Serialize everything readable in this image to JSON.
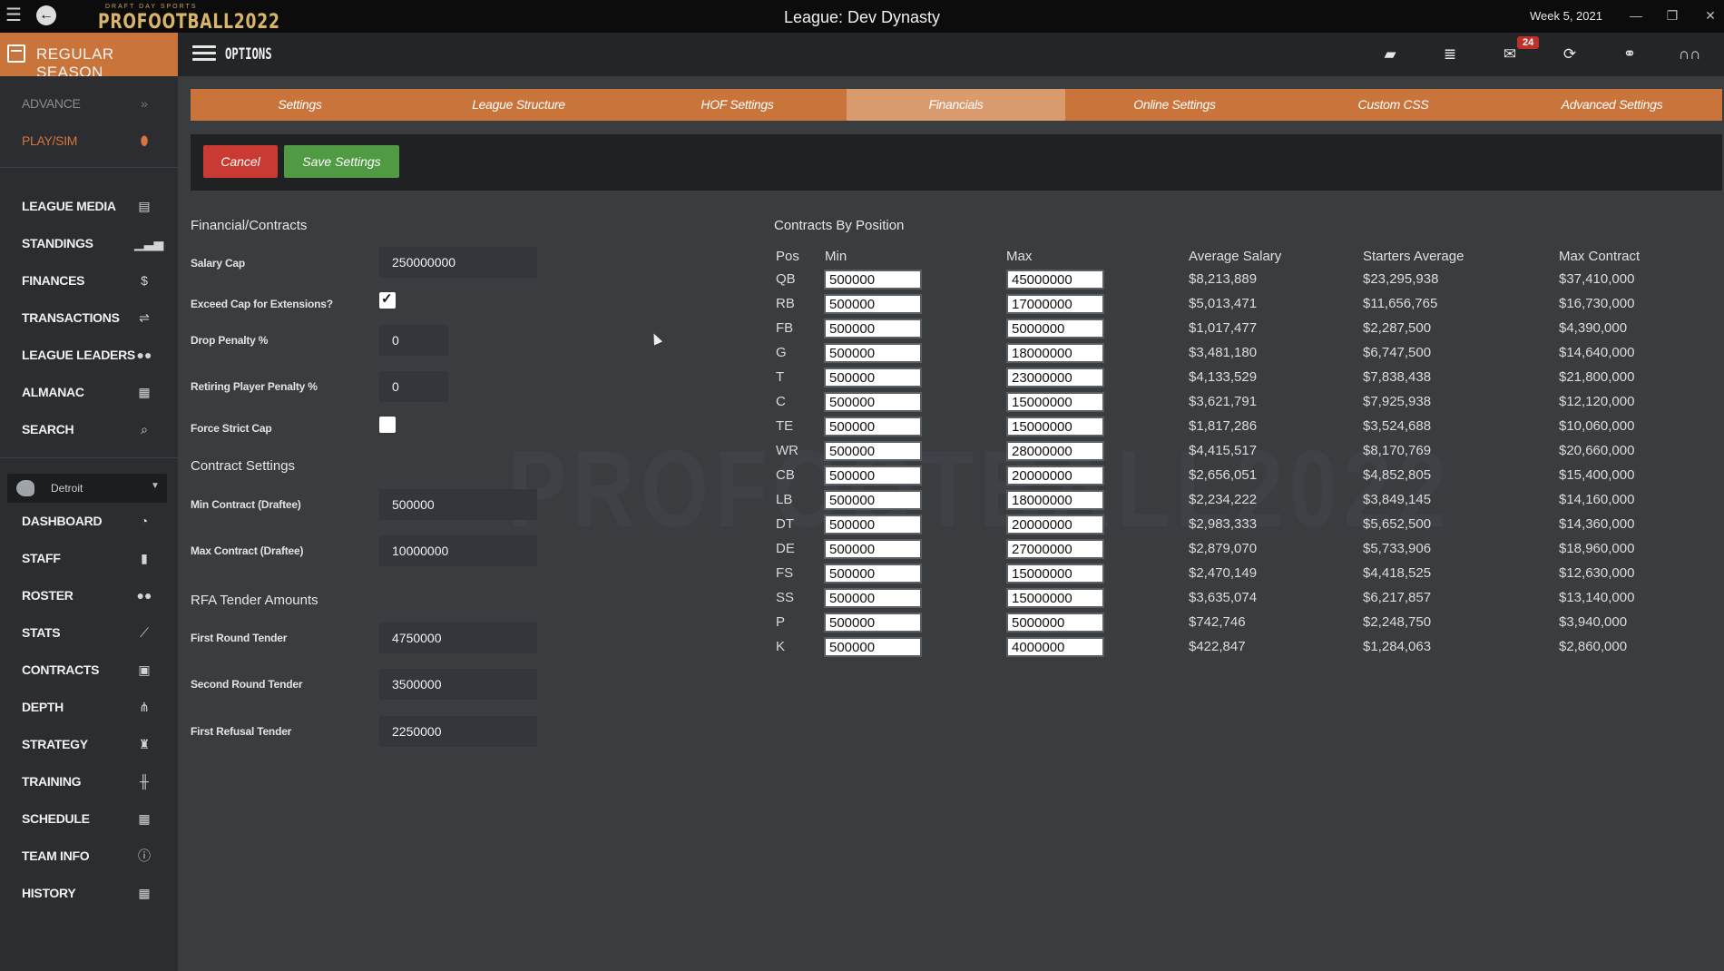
{
  "titlebar": {
    "logo_top": "DRAFT DAY SPORTS",
    "logo_main": "PROFOOTBALL2022",
    "league_title": "League: Dev Dynasty",
    "week": "Week 5, 2021"
  },
  "phasebar": {
    "season_label": "REGULAR SEASON",
    "options_label": "OPTIONS",
    "mail_badge": "24"
  },
  "sidebar": {
    "advance": "ADVANCE",
    "playsim": "PLAY/SIM",
    "league_items": [
      "LEAGUE MEDIA",
      "STANDINGS",
      "FINANCES",
      "TRANSACTIONS",
      "LEAGUE LEADERS",
      "ALMANAC",
      "SEARCH"
    ],
    "team_name": "Detroit",
    "team_items": [
      "DASHBOARD",
      "STAFF",
      "ROSTER",
      "STATS",
      "CONTRACTS",
      "DEPTH",
      "STRATEGY",
      "TRAINING",
      "SCHEDULE",
      "TEAM INFO",
      "HISTORY"
    ]
  },
  "tabs": [
    "Settings",
    "League Structure",
    "HOF Settings",
    "Financials",
    "Online Settings",
    "Custom CSS",
    "Advanced Settings"
  ],
  "active_tab": "Financials",
  "actions": {
    "cancel": "Cancel",
    "save": "Save Settings"
  },
  "financial": {
    "title": "Financial/Contracts",
    "salary_cap_label": "Salary Cap",
    "salary_cap": "250000000",
    "exceed_cap_label": "Exceed Cap for Extensions?",
    "exceed_cap": true,
    "drop_penalty_label": "Drop Penalty %",
    "drop_penalty": "0",
    "retiring_penalty_label": "Retiring Player Penalty %",
    "retiring_penalty": "0",
    "force_strict_label": "Force Strict Cap",
    "force_strict": false
  },
  "contract_settings": {
    "title": "Contract Settings",
    "min_label": "Min Contract (Draftee)",
    "min": "500000",
    "max_label": "Max Contract (Draftee)",
    "max": "10000000"
  },
  "rfa": {
    "title": "RFA Tender Amounts",
    "first_label": "First Round Tender",
    "first": "4750000",
    "second_label": "Second Round Tender",
    "second": "3500000",
    "refusal_label": "First Refusal Tender",
    "refusal": "2250000"
  },
  "contracts_by_position": {
    "title": "Contracts By Position",
    "headers": [
      "Pos",
      "Min",
      "Max",
      "Average Salary",
      "Starters Average",
      "Max Contract"
    ],
    "rows": [
      {
        "pos": "QB",
        "min": "500000",
        "max": "45000000",
        "avg": "$8,213,889",
        "starters": "$23,295,938",
        "maxc": "$37,410,000"
      },
      {
        "pos": "RB",
        "min": "500000",
        "max": "17000000",
        "avg": "$5,013,471",
        "starters": "$11,656,765",
        "maxc": "$16,730,000"
      },
      {
        "pos": "FB",
        "min": "500000",
        "max": "5000000",
        "avg": "$1,017,477",
        "starters": "$2,287,500",
        "maxc": "$4,390,000"
      },
      {
        "pos": "G",
        "min": "500000",
        "max": "18000000",
        "avg": "$3,481,180",
        "starters": "$6,747,500",
        "maxc": "$14,640,000"
      },
      {
        "pos": "T",
        "min": "500000",
        "max": "23000000",
        "avg": "$4,133,529",
        "starters": "$7,838,438",
        "maxc": "$21,800,000"
      },
      {
        "pos": "C",
        "min": "500000",
        "max": "15000000",
        "avg": "$3,621,791",
        "starters": "$7,925,938",
        "maxc": "$12,120,000"
      },
      {
        "pos": "TE",
        "min": "500000",
        "max": "15000000",
        "avg": "$1,817,286",
        "starters": "$3,524,688",
        "maxc": "$10,060,000"
      },
      {
        "pos": "WR",
        "min": "500000",
        "max": "28000000",
        "avg": "$4,415,517",
        "starters": "$8,170,769",
        "maxc": "$20,660,000"
      },
      {
        "pos": "CB",
        "min": "500000",
        "max": "20000000",
        "avg": "$2,656,051",
        "starters": "$4,852,805",
        "maxc": "$15,400,000"
      },
      {
        "pos": "LB",
        "min": "500000",
        "max": "18000000",
        "avg": "$2,234,222",
        "starters": "$3,849,145",
        "maxc": "$14,160,000"
      },
      {
        "pos": "DT",
        "min": "500000",
        "max": "20000000",
        "avg": "$2,983,333",
        "starters": "$5,652,500",
        "maxc": "$14,360,000"
      },
      {
        "pos": "DE",
        "min": "500000",
        "max": "27000000",
        "avg": "$2,879,070",
        "starters": "$5,733,906",
        "maxc": "$18,960,000"
      },
      {
        "pos": "FS",
        "min": "500000",
        "max": "15000000",
        "avg": "$2,470,149",
        "starters": "$4,418,525",
        "maxc": "$12,630,000"
      },
      {
        "pos": "SS",
        "min": "500000",
        "max": "15000000",
        "avg": "$3,635,074",
        "starters": "$6,217,857",
        "maxc": "$13,140,000"
      },
      {
        "pos": "P",
        "min": "500000",
        "max": "5000000",
        "avg": "$742,746",
        "starters": "$2,248,750",
        "maxc": "$3,940,000"
      },
      {
        "pos": "K",
        "min": "500000",
        "max": "4000000",
        "avg": "$422,847",
        "starters": "$1,284,063",
        "maxc": "$2,860,000"
      }
    ]
  },
  "colors": {
    "accent": "#c8743a",
    "active_tab": "#d99a6e",
    "cancel": "#c93a33",
    "save": "#4f9a43"
  },
  "watermark": "PROFOOTBALL2022"
}
